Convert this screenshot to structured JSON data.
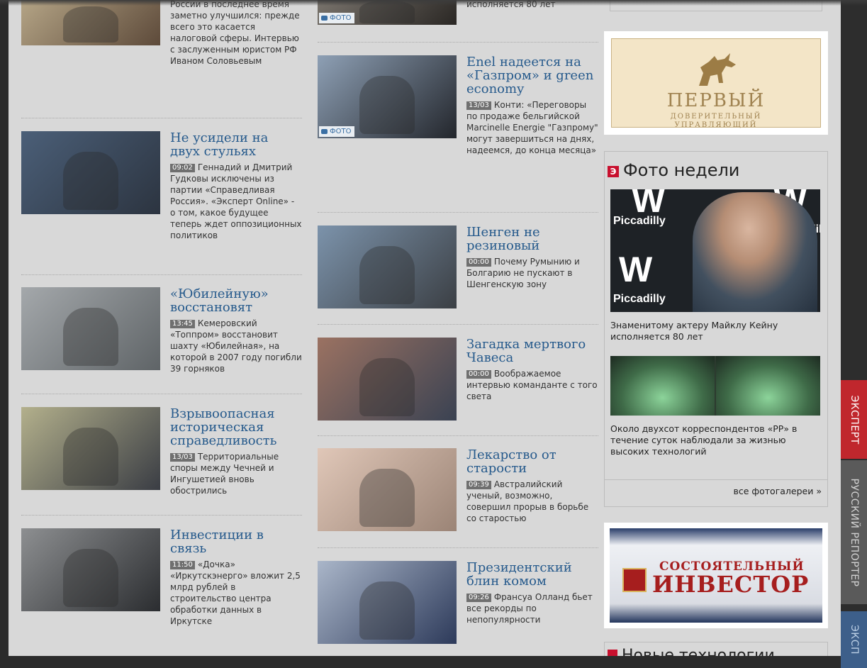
{
  "left_column": [
    {
      "title": "",
      "time": "",
      "text": "России в последнее время заметно улучшился: прежде всего это касается налоговой сферы. Интервью с заслуженным юристом РФ Иваном Соловьевым",
      "colors": [
        "#b8a889",
        "#5d4a3a"
      ]
    },
    {
      "title": "Не усидели на двух стульях",
      "time": "09:02",
      "text": "Геннадий и Дмитрий Гудковы исключены из партии «Справедливая Россия». «Эксперт Online» - о том, какое будущее теперь ждет оппозиционных политиков",
      "colors": [
        "#4b5f78",
        "#2c3440"
      ]
    },
    {
      "title": "«Юбилейную» восстановят",
      "time": "13:45",
      "text": "Кемеровский «Топпром» восстановит шахту «Юбилейная», на которой в 2007 году погибли 39 горняков",
      "colors": [
        "#a4a8ab",
        "#5f6467"
      ]
    },
    {
      "title": "Взрывоопасная историческая справедливость",
      "time": "13/03",
      "text": "Территориальные споры между Чечней и Ингушетией вновь обострились",
      "colors": [
        "#b3b08c",
        "#3a3d44"
      ]
    },
    {
      "title": "Инвестиции в связь",
      "time": "11:50",
      "text": "«Дочка» «Иркутскэнерго» вложит 2,5 млрд рублей в строительство центра обработки данных в Иркутске",
      "colors": [
        "#8d8f91",
        "#2b2d30"
      ]
    }
  ],
  "middle_column": [
    {
      "title": "",
      "time": "",
      "text": "исполняется 80 лет",
      "badge": "ФОТО",
      "colors": [
        "#7d7770",
        "#2a2724"
      ]
    },
    {
      "title": "Enel надеется на «Газпром» и green economy",
      "time": "13/03",
      "text": "Конти: «Переговоры по продаже бельгийской Marcinelle Energie \"Газпрому\" могут завершиться на днях, надеемся, до конца месяца»",
      "badge": "ФОТО",
      "colors": [
        "#8ea0b5",
        "#23262c"
      ]
    },
    {
      "title": "Шенген не резиновый",
      "time": "00:00",
      "text": "Почему Румынию и Болгарию не пускают в Шенгенскую зону",
      "badge": "",
      "colors": [
        "#7c93ab",
        "#3b3f44"
      ]
    },
    {
      "title": "Загадка мертвого Чавеса",
      "time": "00:00",
      "text": "Воображаемое интервью команданте с того света",
      "badge": "",
      "colors": [
        "#9b7262",
        "#3a4252"
      ]
    },
    {
      "title": "Лекарство от старости",
      "time": "09:39",
      "text": "Австралийский ученый, возможно, совершил прорыв в борьбе со старостью",
      "badge": "",
      "colors": [
        "#e0c7b8",
        "#9b8476"
      ]
    },
    {
      "title": "Президентский блин комом",
      "time": "09:26",
      "text": "Франсуа Олланд бьет все рекорды по непопулярности",
      "badge": "",
      "colors": [
        "#aab6c9",
        "#2d3a5a"
      ]
    }
  ],
  "sidebar": {
    "ad_perviy": {
      "title": "ПЕРВЫЙ",
      "sub1": "ДОВЕРИТЕЛЬНЫЙ",
      "sub2": "УПРАВЛЯЮЩИЙ"
    },
    "photo_week": {
      "heading_icon": "Э",
      "heading": "Фото недели",
      "brand_text": "Piccadilly",
      "caption1": "Знаменитому актеру Майклу Кейну исполняется 80 лет",
      "caption2": "Около двухсот корреспондентов «РР» в течение суток наблюдали за жизнью высоких технологий",
      "more": "все фотогалереи"
    },
    "ad_investor": {
      "line1": "СОСТОЯТЕЛЬНЫЙ",
      "line2": "ИНВЕСТОР"
    },
    "new_tech": "Новые технологии"
  },
  "rail_tabs": [
    "ЭКСПЕРТ",
    "РУССКИЙ РЕПОРТЕР",
    "ЭКСП"
  ],
  "colors": {
    "link": "#265a8c",
    "accent_red": "#c0272d",
    "time_badge": "#6f6f6f"
  }
}
